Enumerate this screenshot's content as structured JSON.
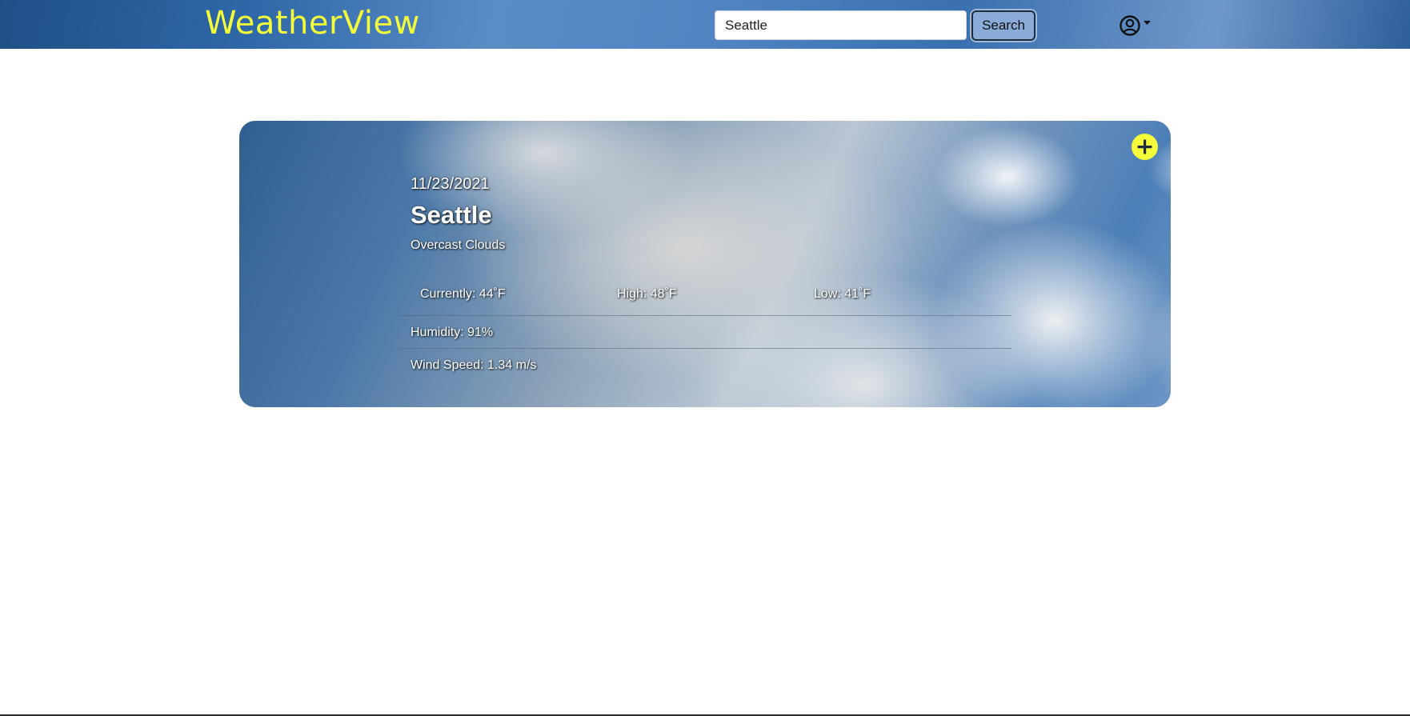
{
  "navbar": {
    "brand": "WeatherView",
    "search": {
      "value": "Seattle",
      "placeholder": ""
    },
    "search_button_label": "Search",
    "user_icon": "user-circle-icon",
    "dropdown_icon": "caret-down-icon"
  },
  "weather": {
    "date": "11/23/2021",
    "city": "Seattle",
    "description": "Overcast Clouds",
    "currently": "Currently: 44˚F",
    "high": "High: 48˚F",
    "low": "Low: 41˚F",
    "humidity": "Humidity: 91%",
    "wind_speed": "Wind Speed: 1.34 m/s",
    "add_icon": "plus-icon"
  },
  "colors": {
    "brand": "#f4ff3a",
    "navbar": "#2f68a8",
    "button": "#8aaad8"
  }
}
